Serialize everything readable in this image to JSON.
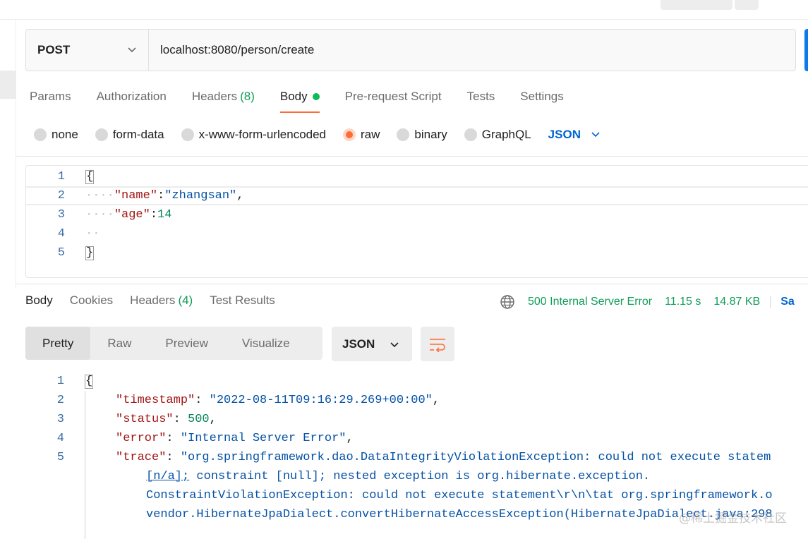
{
  "request": {
    "method": "POST",
    "url": "localhost:8080/person/create"
  },
  "request_tabs": [
    {
      "label": "Params"
    },
    {
      "label": "Authorization"
    },
    {
      "label": "Headers",
      "count": "(8)"
    },
    {
      "label": "Body"
    },
    {
      "label": "Pre-request Script"
    },
    {
      "label": "Tests"
    },
    {
      "label": "Settings"
    }
  ],
  "body_types": [
    "none",
    "form-data",
    "x-www-form-urlencoded",
    "raw",
    "binary",
    "GraphQL"
  ],
  "body_language": "JSON",
  "request_body": {
    "line_numbers": [
      "1",
      "2",
      "3",
      "4",
      "5"
    ],
    "open_brace": "{",
    "close_brace": "}",
    "indent": "····",
    "indent_short": "··",
    "name_key": "\"name\"",
    "name_value": "\"zhangsan\"",
    "age_key": "\"age\"",
    "age_value": "14"
  },
  "response_tabs": [
    {
      "label": "Body"
    },
    {
      "label": "Cookies"
    },
    {
      "label": "Headers",
      "count": "(4)"
    },
    {
      "label": "Test Results"
    }
  ],
  "response_status": {
    "status": "500 Internal Server Error",
    "time": "11.15 s",
    "size": "14.87 KB",
    "save_label": "Sa"
  },
  "view_modes": [
    "Pretty",
    "Raw",
    "Preview",
    "Visualize"
  ],
  "response_format": "JSON",
  "response_body": {
    "line_numbers": [
      "1",
      "2",
      "3",
      "4",
      "5"
    ],
    "open_brace": "{",
    "timestamp_key": "\"timestamp\"",
    "timestamp_value": "\"2022-08-11T09:16:29.269+00:00\"",
    "status_key": "\"status\"",
    "status_value": "500",
    "error_key": "\"error\"",
    "error_value": "\"Internal Server Error\"",
    "trace_key": "\"trace\"",
    "trace_line1": "\"org.springframework.dao.DataIntegrityViolationException: could not execute statem",
    "trace_line2a": "[n/a];",
    "trace_line2b": " constraint [null]; nested exception is org.hibernate.exception.",
    "trace_line3": "ConstraintViolationException: could not execute statement\\r\\n\\tat org.springframework.o",
    "trace_line4": "vendor.HibernateJpaDialect.convertHibernateAccessException(HibernateJpaDialect.java:298"
  },
  "watermark": "@稀土掘金技术社区",
  "colors": {
    "accent_orange": "#ff6c37",
    "status_green": "#0f9d58",
    "link_blue": "#0265d2",
    "send_blue": "#097bed"
  }
}
